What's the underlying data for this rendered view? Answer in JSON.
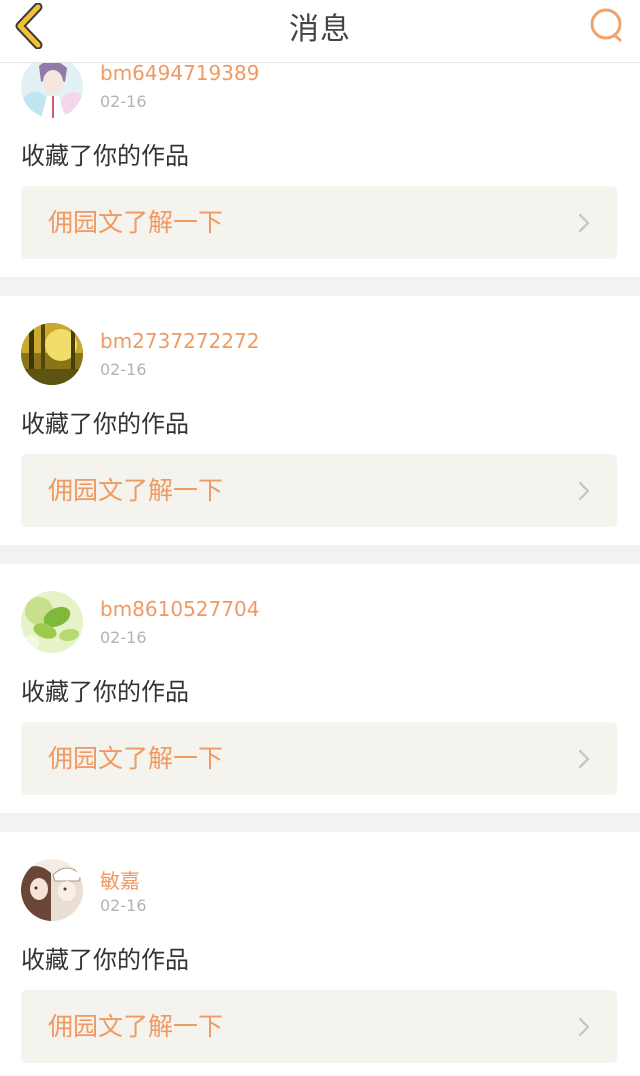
{
  "header": {
    "title": "消息",
    "back_icon": "chevron-left-icon",
    "search_icon": "search-icon",
    "accent_color": "#f0a26b",
    "back_color": "#f1c232"
  },
  "messages": [
    {
      "username": "bm6494719389",
      "date": "02-16",
      "action": "收藏了你的作品",
      "promo": "佣园文了解一下",
      "avatar": "anime-boy-avatar"
    },
    {
      "username": "bm2737272272",
      "date": "02-16",
      "action": "收藏了你的作品",
      "promo": "佣园文了解一下",
      "avatar": "forest-sunlight-avatar"
    },
    {
      "username": "bm8610527704",
      "date": "02-16",
      "action": "收藏了你的作品",
      "promo": "佣园文了解一下",
      "avatar": "green-leaves-avatar"
    },
    {
      "username": "敏嘉",
      "date": "02-16",
      "action": "收藏了你的作品",
      "promo": "佣园文了解一下",
      "avatar": "anime-couple-avatar"
    }
  ]
}
